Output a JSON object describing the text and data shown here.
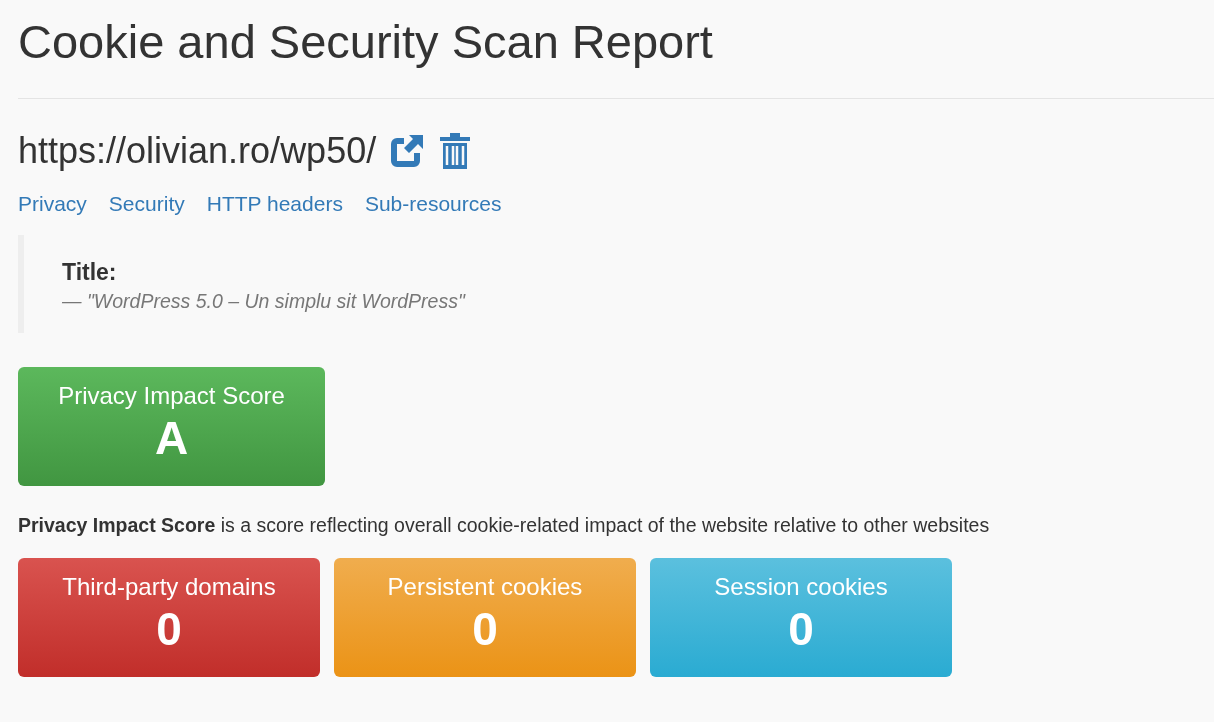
{
  "page_title": "Cookie and Security Scan Report",
  "site": {
    "url": "https://olivian.ro/wp50/"
  },
  "nav_links": [
    {
      "label": "Privacy"
    },
    {
      "label": "Security"
    },
    {
      "label": "HTTP headers"
    },
    {
      "label": "Sub-resources"
    }
  ],
  "title_quote": {
    "label": "Title:",
    "value": "— \"WordPress 5.0 – Un simplu sit WordPress\""
  },
  "score": {
    "label": "Privacy Impact Score",
    "value": "A",
    "kind": "success"
  },
  "description": "**Privacy Impact Score** is a score reflecting overall cookie-related impact of the website relative to other websites",
  "stats": [
    {
      "label": "Third-party domains",
      "value": "0",
      "kind": "danger"
    },
    {
      "label": "Persistent cookies",
      "value": "0",
      "kind": "warning"
    },
    {
      "label": "Session cookies",
      "value": "0",
      "kind": "info"
    }
  ]
}
